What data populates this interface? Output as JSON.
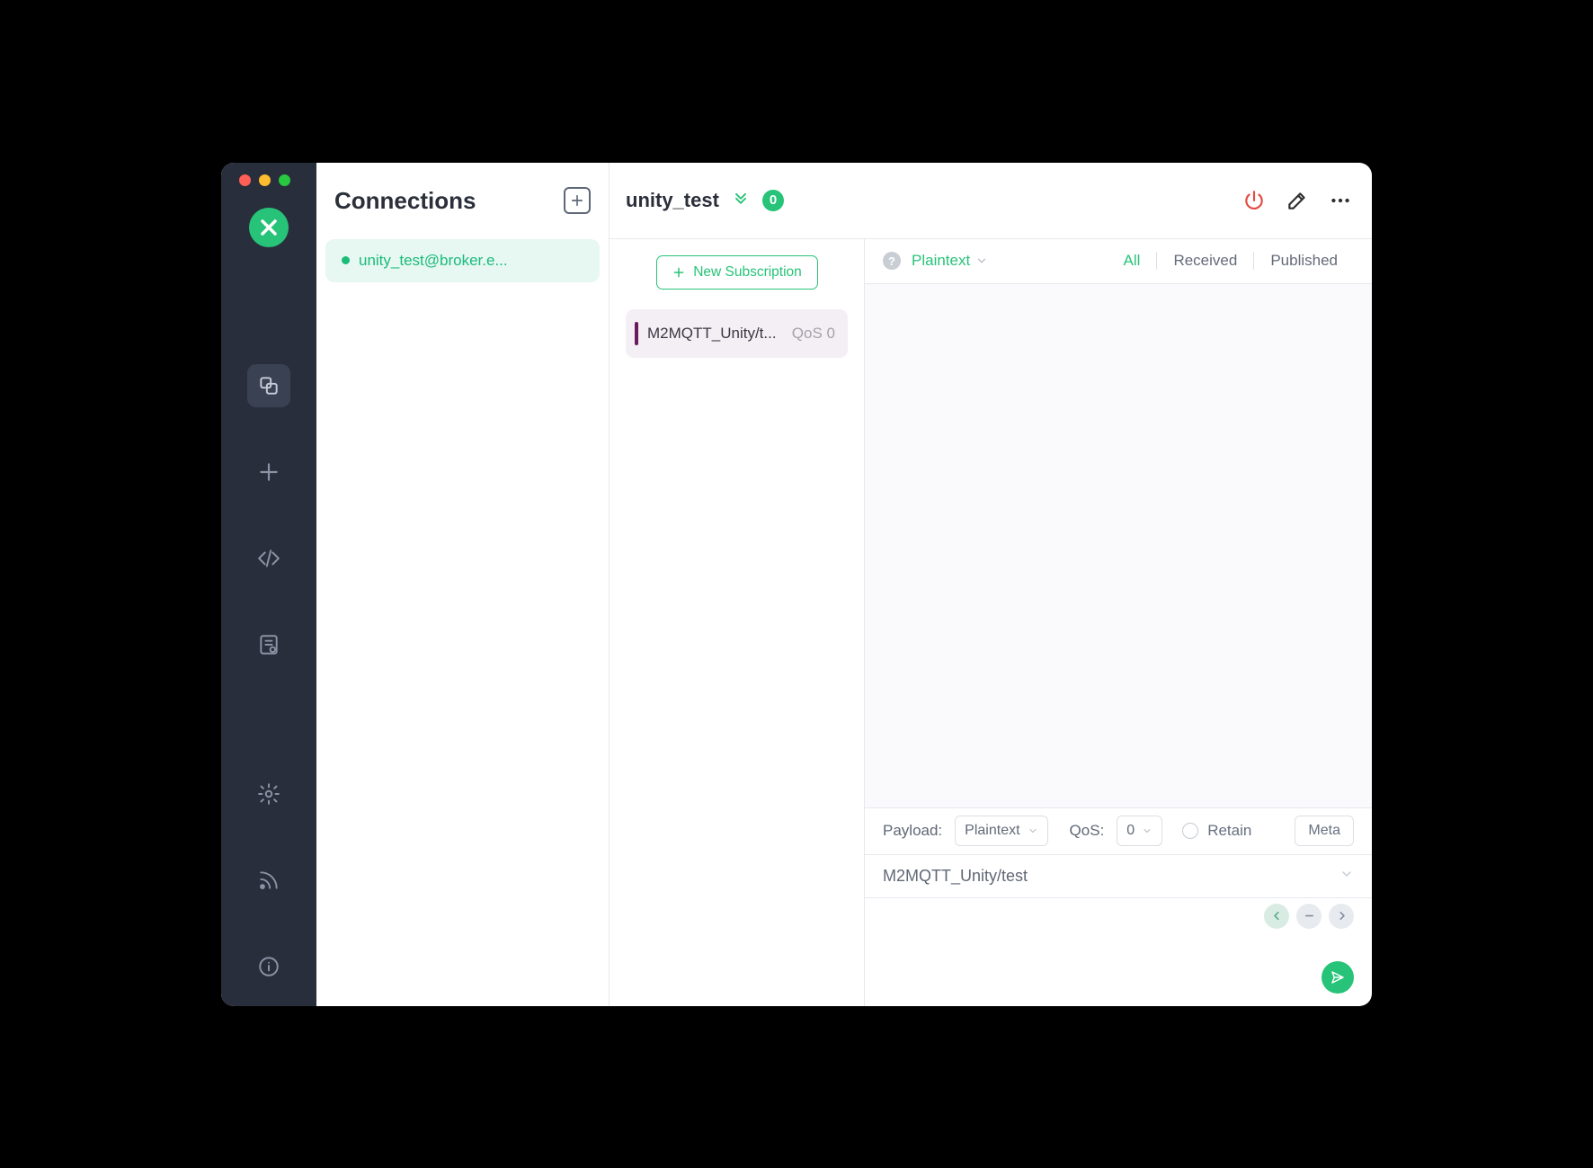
{
  "sidebar": {
    "title": "Connections",
    "items": [
      {
        "name": "unity_test@broker.e..."
      }
    ]
  },
  "header": {
    "connection_name": "unity_test",
    "badge": "0"
  },
  "subscriptions": {
    "new_label": "New Subscription",
    "items": [
      {
        "topic": "M2MQTT_Unity/t...",
        "qos": "QoS 0"
      }
    ]
  },
  "messages": {
    "format": "Plaintext",
    "tabs": {
      "all": "All",
      "received": "Received",
      "published": "Published"
    }
  },
  "publish": {
    "payload_label": "Payload:",
    "payload_format": "Plaintext",
    "qos_label": "QoS:",
    "qos_value": "0",
    "retain_label": "Retain",
    "meta_label": "Meta",
    "topic": "M2MQTT_Unity/test"
  }
}
